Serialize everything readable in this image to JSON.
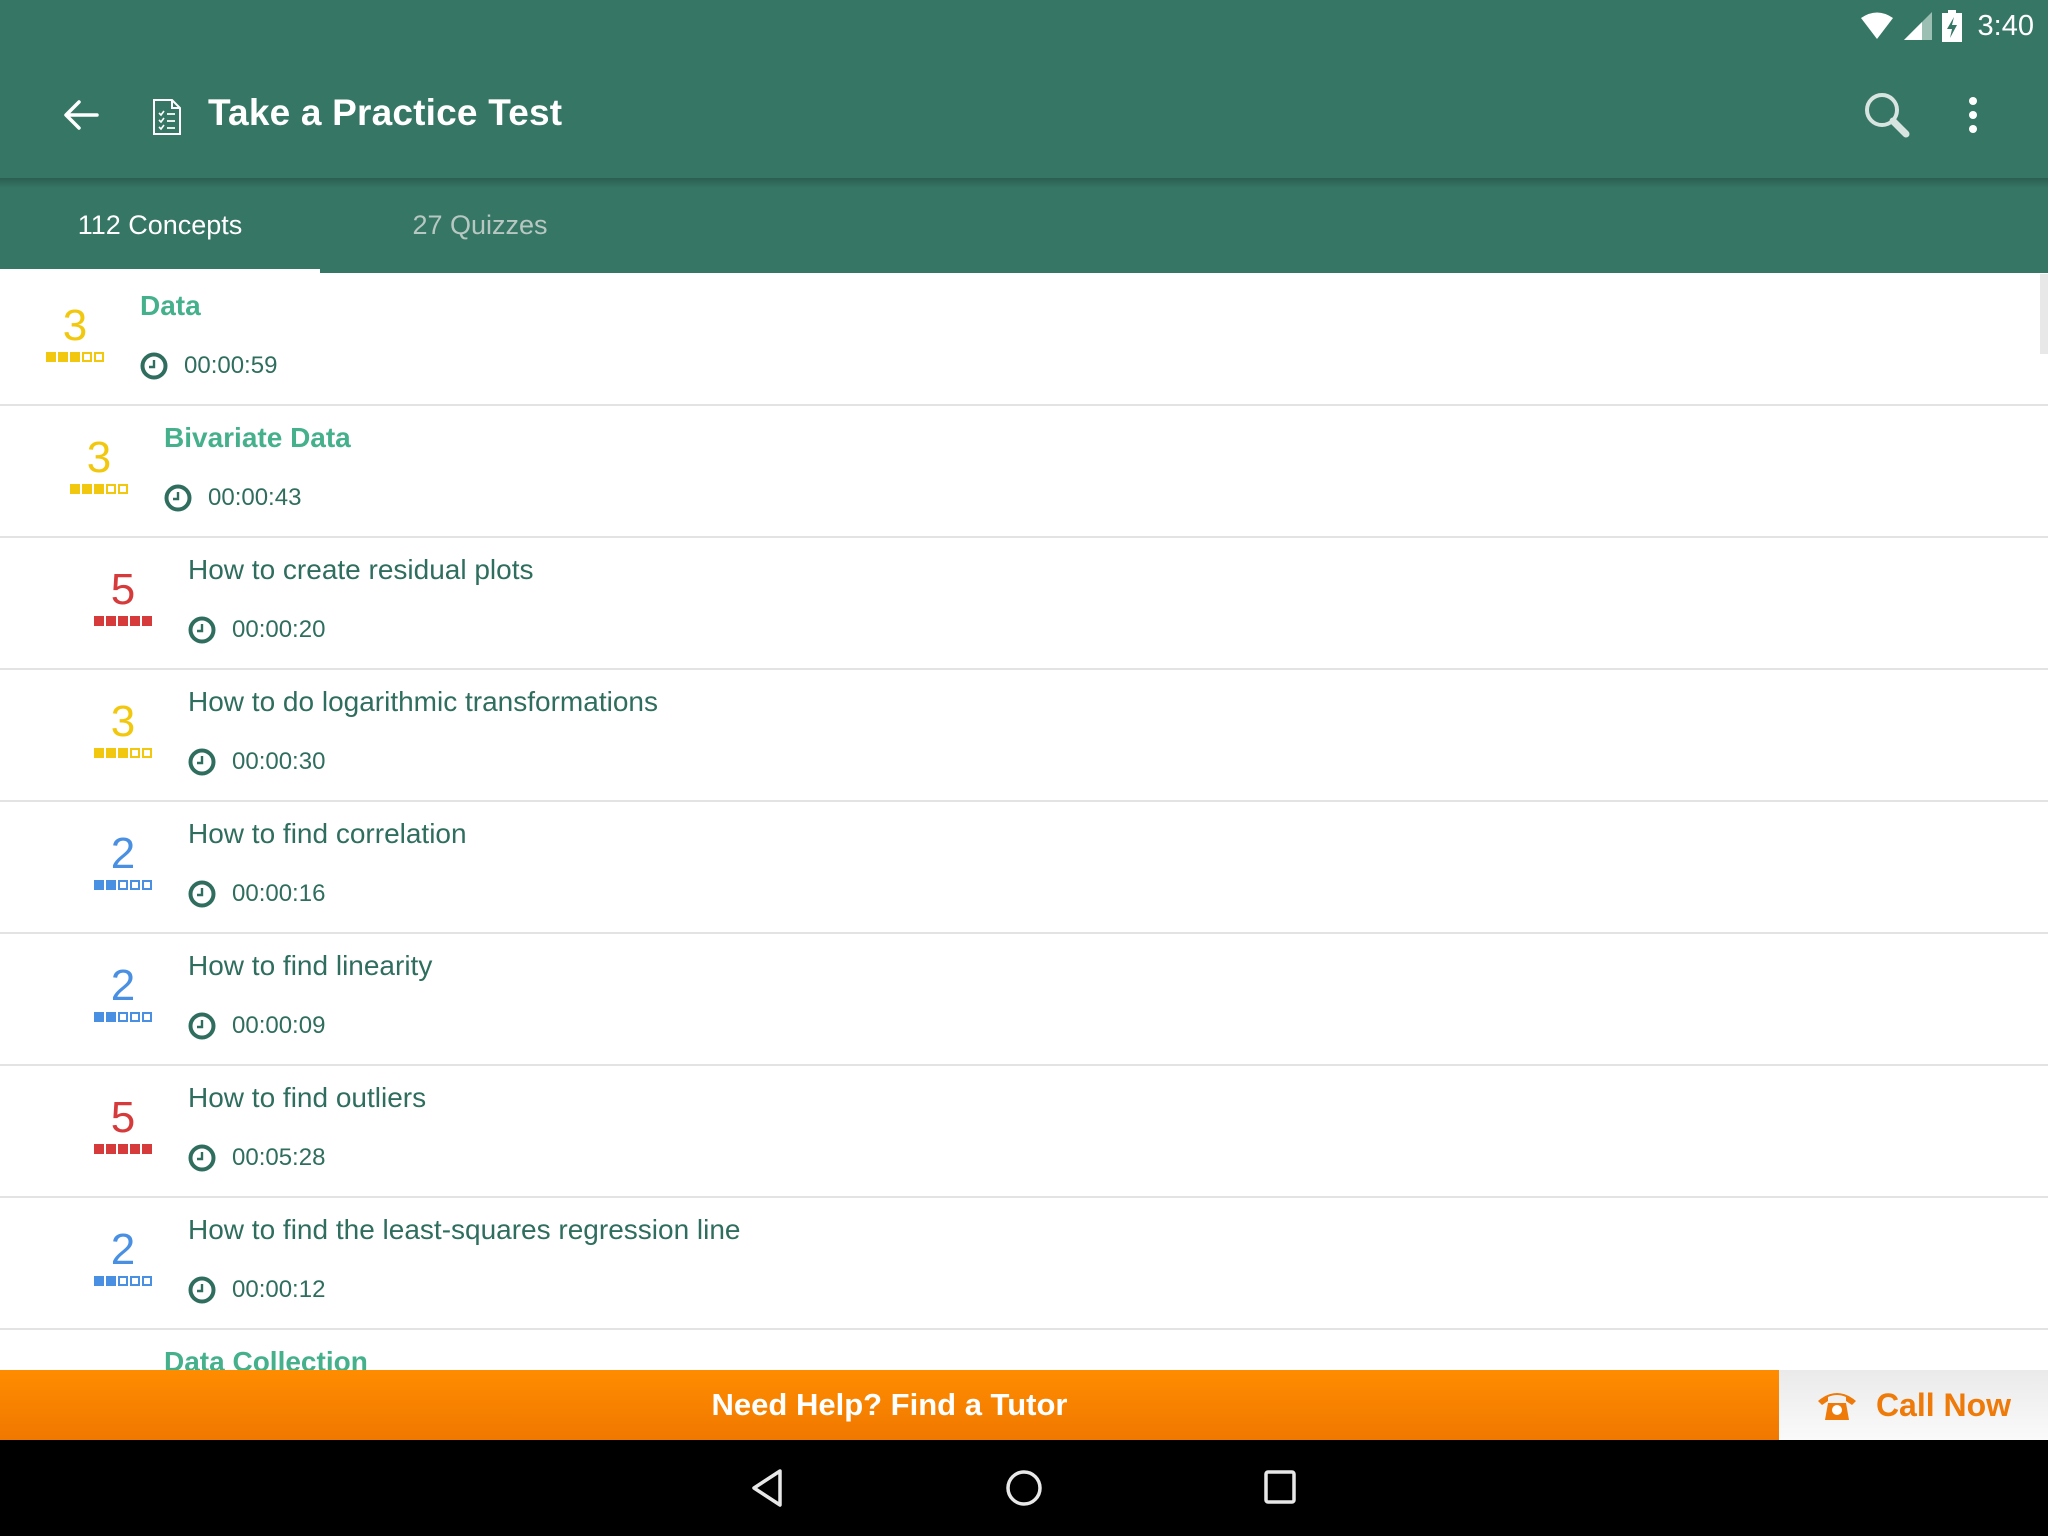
{
  "status_bar": {
    "time": "3:40",
    "icons": [
      "wifi-icon",
      "cell-signal-icon",
      "battery-charging-icon"
    ]
  },
  "toolbar": {
    "back_icon": "arrow-left-icon",
    "title_icon": "checklist-document-icon",
    "title": "Take a Practice Test",
    "actions": [
      "search-icon",
      "more-vert-icon"
    ]
  },
  "tabs": [
    {
      "label": "112 Concepts",
      "active": true
    },
    {
      "label": "27 Quizzes",
      "active": false
    }
  ],
  "colors": {
    "primary": "#367665",
    "section_title": "#45b08c",
    "item_title": "#2f6e5e",
    "level_2": "#4a90e2",
    "level_3": "#f2c80f",
    "level_5": "#d63a3a",
    "banner_orange": "#ff8c00",
    "call_now": "#ee7a0a"
  },
  "list": {
    "rows": [
      {
        "type": "section",
        "indent": 0,
        "title": "Data",
        "difficulty": 3,
        "time": "00:00:59"
      },
      {
        "type": "section",
        "indent": 1,
        "title": "Bivariate Data",
        "difficulty": 3,
        "time": "00:00:43"
      },
      {
        "type": "item",
        "indent": 2,
        "title": "How to create residual plots",
        "difficulty": 5,
        "time": "00:00:20"
      },
      {
        "type": "item",
        "indent": 2,
        "title": "How to do logarithmic transformations",
        "difficulty": 3,
        "time": "00:00:30"
      },
      {
        "type": "item",
        "indent": 2,
        "title": "How to find correlation",
        "difficulty": 2,
        "time": "00:00:16"
      },
      {
        "type": "item",
        "indent": 2,
        "title": "How to find linearity",
        "difficulty": 2,
        "time": "00:00:09"
      },
      {
        "type": "item",
        "indent": 2,
        "title": "How to find outliers",
        "difficulty": 5,
        "time": "00:05:28"
      },
      {
        "type": "item",
        "indent": 2,
        "title": "How to find the least-squares regression line",
        "difficulty": 2,
        "time": "00:00:12"
      },
      {
        "type": "section",
        "indent": 1,
        "title": "Data Collection",
        "difficulty": null,
        "time": null
      }
    ],
    "difficulty_max": 5
  },
  "banner": {
    "text": "Need Help? Find a Tutor",
    "call_label": "Call Now",
    "call_icon": "telephone-icon"
  },
  "nav_bar": {
    "buttons": [
      "back-triangle-icon",
      "home-circle-icon",
      "recents-square-icon"
    ]
  }
}
